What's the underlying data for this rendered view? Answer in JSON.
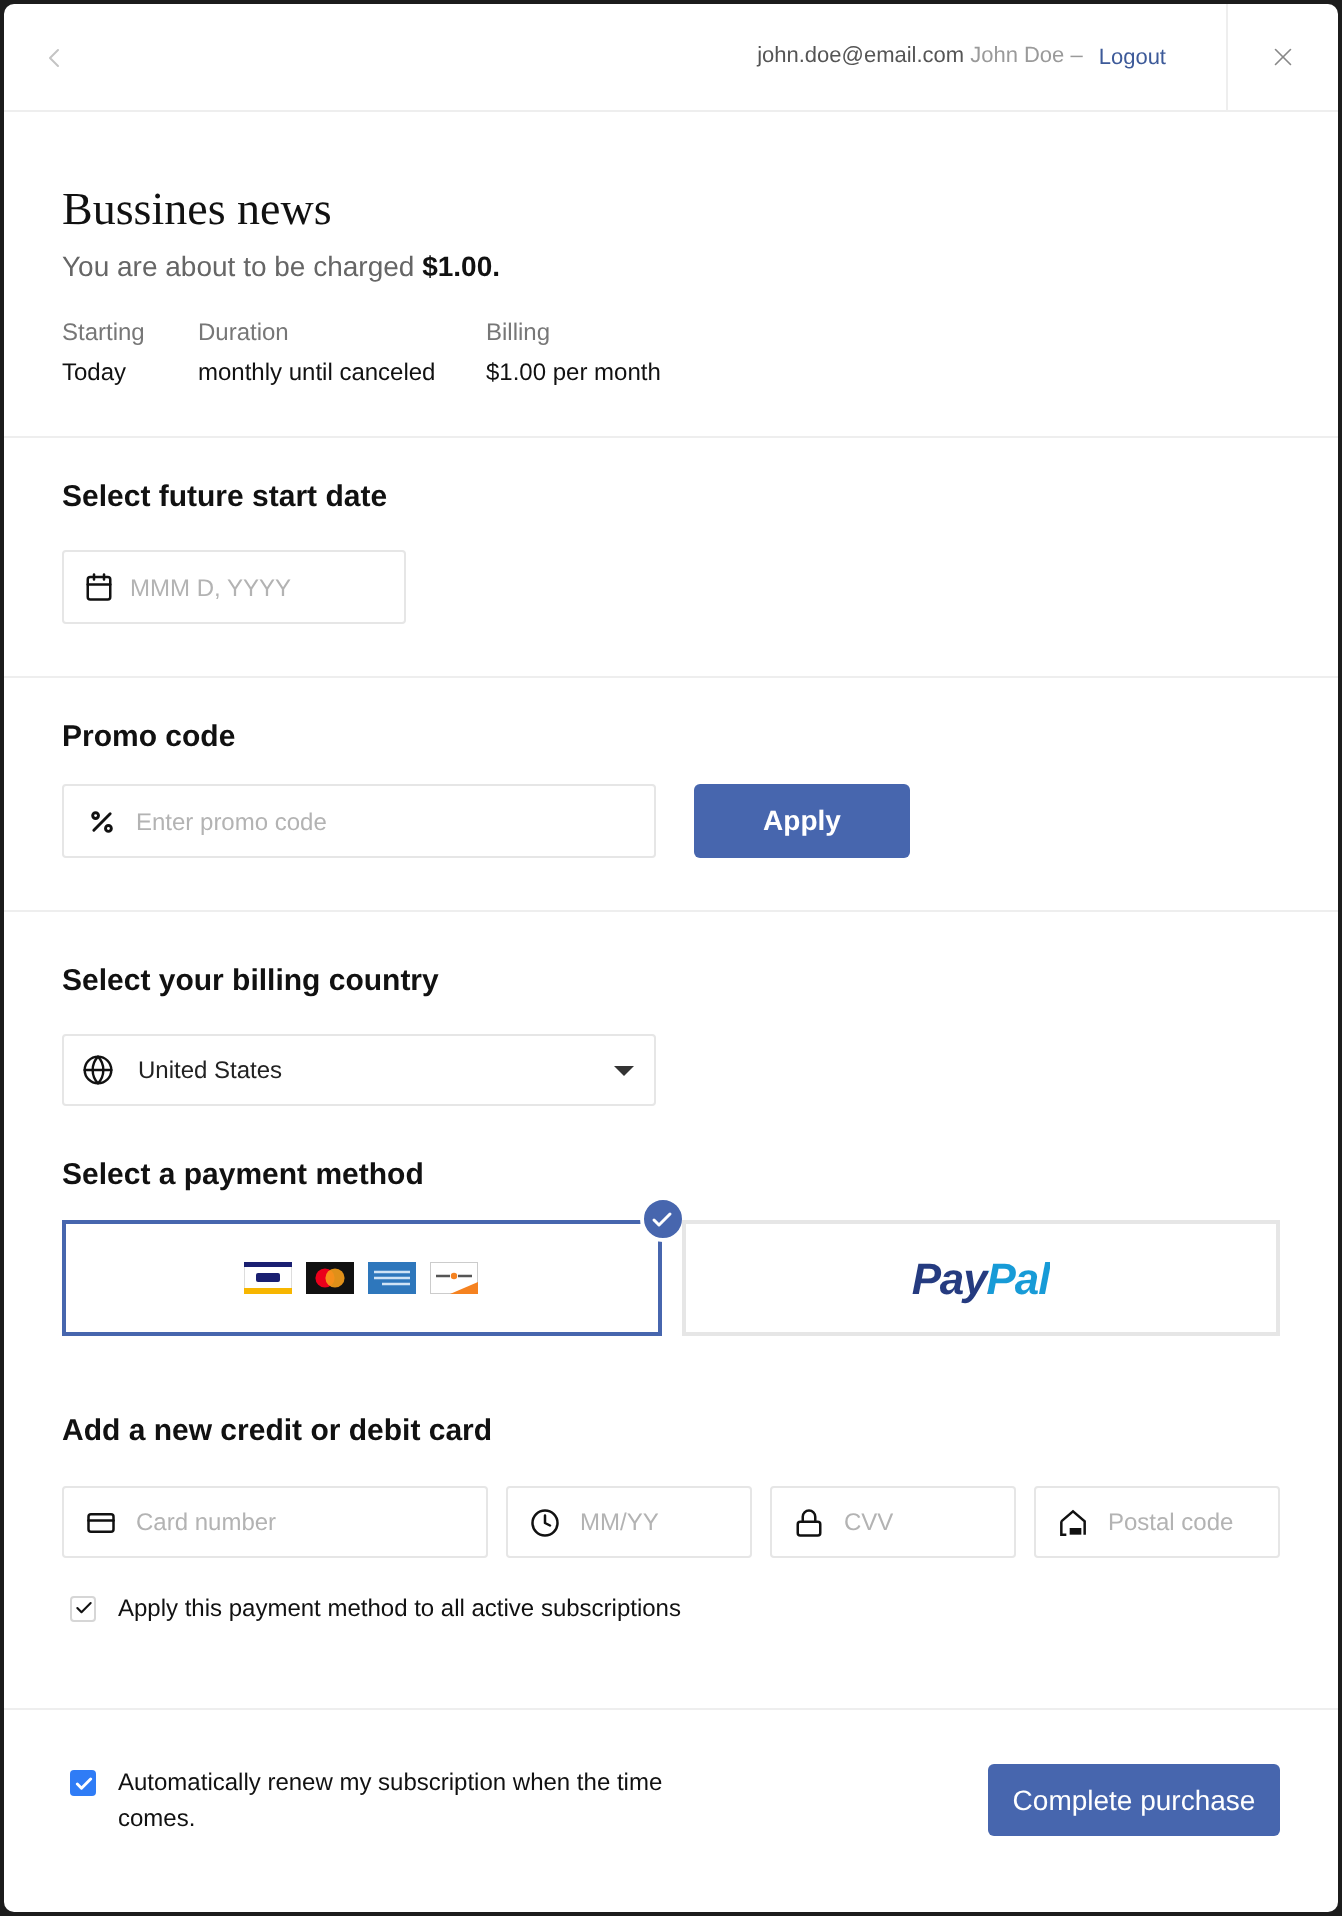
{
  "header": {
    "email": "john.doe@email.com",
    "name": "John Doe –",
    "logout": "Logout"
  },
  "product": {
    "title": "Bussines news",
    "charge_notice": "You are about to be charged **$1.00.**",
    "details": [
      {
        "label": "Starting",
        "value": "Today"
      },
      {
        "label": "Duration",
        "value": "monthly until canceled"
      },
      {
        "label": "Billing",
        "value": "$1.00 per month"
      }
    ]
  },
  "start_date": {
    "heading": "Select future start date",
    "placeholder": "MMM D, YYYY"
  },
  "promo": {
    "heading": "Promo code",
    "placeholder": "Enter promo code",
    "button": "Apply"
  },
  "billing_country": {
    "heading": "Select your billing country",
    "value": "United States"
  },
  "payment_methods": {
    "heading": "Select a payment method",
    "options": [
      {
        "kind": "cards",
        "selected": true,
        "logos": [
          {
            "kind": "visa"
          },
          {
            "kind": "mastercard"
          },
          {
            "kind": "amex"
          },
          {
            "kind": "discover"
          }
        ]
      },
      {
        "kind": "paypal",
        "selected": false,
        "label": "PayPal"
      }
    ]
  },
  "new_card": {
    "heading": "Add a new credit or debit card",
    "fields": [
      {
        "kind": "card",
        "placeholder": "Card number"
      },
      {
        "kind": "expiry",
        "placeholder": "MM/YY"
      },
      {
        "kind": "cvv",
        "placeholder": "CVV"
      },
      {
        "kind": "postal",
        "placeholder": "Postal code"
      }
    ],
    "apply_all": {
      "label": "Apply this payment method to all active subscriptions",
      "checked": true
    }
  },
  "footer": {
    "auto_renew": {
      "label": "Automatically renew my subscription when the time comes.",
      "checked": true
    },
    "button": "Complete purchase"
  }
}
